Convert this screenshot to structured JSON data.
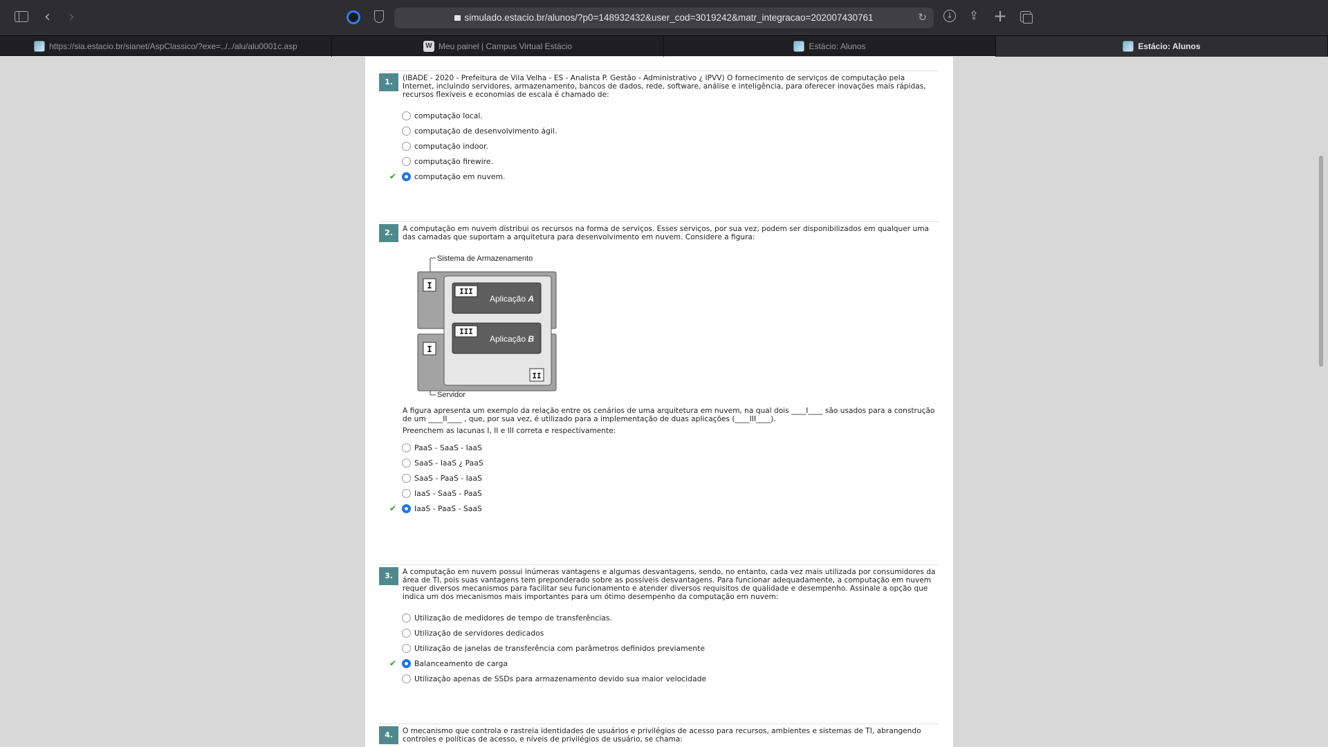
{
  "browser": {
    "url": "simulado.estacio.br/alunos/?p0=148932432&user_cod=3019242&matr_integracao=202007430761",
    "tabs": [
      {
        "label": "https://sia.estacio.br/sianet/AspClassico/?exe=../../alu/alu0001c.asp"
      },
      {
        "label": "Meu painel | Campus Virtual Estácio"
      },
      {
        "label": "Estácio: Alunos"
      },
      {
        "label": "Estácio: Alunos"
      }
    ]
  },
  "questions": [
    {
      "number": "1.",
      "text": "(IBADE - 2020 - Prefeitura de Vila Velha - ES - Analista P. Gestão - Administrativo ¿ IPVV) O fornecimento de serviços de computação pela Internet, incluindo servidores, armazenamento, bancos de dados, rede, software, análise e inteligência, para oferecer inovações mais rápidas, recursos flexíveis e economias de escala é chamado de:",
      "options": [
        {
          "label": "computação local.",
          "selected": false
        },
        {
          "label": "computação de desenvolvimento ágil.",
          "selected": false
        },
        {
          "label": "computação indoor.",
          "selected": false
        },
        {
          "label": "computação firewire.",
          "selected": false
        },
        {
          "label": "computação em nuvem.",
          "selected": true
        }
      ]
    },
    {
      "number": "2.",
      "text": "A computação em nuvem distribui os recursos na forma de serviços. Esses serviços, por sua vez, podem ser disponibilizados em qualquer uma das camadas que suportam a arquitetura para desenvolvimento em nuvem. Considere a figura:",
      "figure": {
        "storage_label": "Sistema de Armazenamento",
        "server_label": "Servidor",
        "marker_I": "I",
        "marker_II": "II",
        "marker_III": "III",
        "app_a_prefix": "Aplicação ",
        "app_a_letter": "A",
        "app_b_prefix": "Aplicação ",
        "app_b_letter": "B"
      },
      "after_figure_text": "A figura apresenta um exemplo da relação entre os cenários de uma arquitetura em nuvem, na qual dois ____I____ são usados para a construção de um ____II____ , que, por sua vez, é utilizado para a implementação de duas aplicações (____III____).",
      "instruction": "Preenchem as lacunas I, II e III correta e respectivamente:",
      "options": [
        {
          "label": "PaaS - SaaS - IaaS",
          "selected": false
        },
        {
          "label": "SaaS - IaaS ¿ PaaS",
          "selected": false
        },
        {
          "label": "SaaS - PaaS - IaaS",
          "selected": false
        },
        {
          "label": "IaaS - SaaS - PaaS",
          "selected": false
        },
        {
          "label": "IaaS - PaaS - SaaS",
          "selected": true
        }
      ]
    },
    {
      "number": "3.",
      "text": "A computação em nuvem possui inúmeras vantagens e algumas desvantagens, sendo, no entanto, cada vez mais utilizada por consumidores da área de TI, pois suas vantagens tem preponderado sobre as possíveis desvantagens. Para funcionar adequadamente, a computação em nuvem requer diversos mecanismos para facilitar seu funcionamento e atender diversos requisitos de qualidade e desempenho. Assinale a opção que indica um dos mecanismos mais importantes para um ótimo desempenho da computação em nuvem:",
      "options": [
        {
          "label": "Utilização de medidores de tempo de transferências.",
          "selected": false
        },
        {
          "label": "Utilização de servidores dedicados",
          "selected": false
        },
        {
          "label": "Utilização de janelas de transferência com parâmetros definidos previamente",
          "selected": false
        },
        {
          "label": "Balanceamento de carga",
          "selected": true
        },
        {
          "label": "Utilização apenas de SSDs para armazenamento devido sua maior velocidade",
          "selected": false
        }
      ]
    },
    {
      "number": "4.",
      "text": "O mecanismo que controla e rastreia identidades de usuários e privilégios de acesso para recursos, ambientes e sistemas de TI, abrangendo controles e políticas de acesso, e níveis de privilégios de usuário, se chama:"
    }
  ],
  "colors": {
    "question_badge": "#4e8a8d",
    "correct_check": "#21a321",
    "selected_radio": "#1a73e8"
  }
}
